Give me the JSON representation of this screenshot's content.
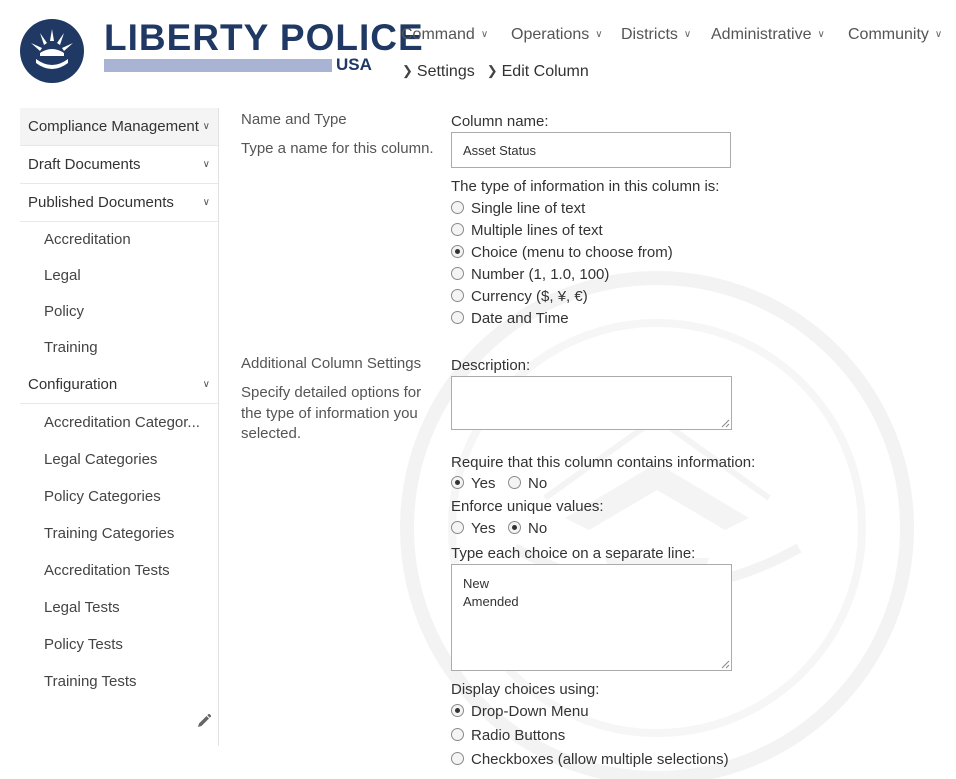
{
  "header": {
    "logo_title": "LIBERTY POLICE",
    "logo_subtitle": "USA",
    "nav": [
      {
        "label": "Command"
      },
      {
        "label": "Operations"
      },
      {
        "label": "Districts"
      },
      {
        "label": "Administrative"
      },
      {
        "label": "Community"
      }
    ],
    "breadcrumb": [
      {
        "label": "Settings"
      },
      {
        "label": "Edit Column"
      }
    ]
  },
  "sidebar": {
    "groups": [
      {
        "label": "Compliance Management",
        "active": true,
        "items": []
      },
      {
        "label": "Draft Documents",
        "items": []
      },
      {
        "label": "Published Documents",
        "items": [
          "Accreditation",
          "Legal",
          "Policy",
          "Training"
        ]
      },
      {
        "label": "Configuration",
        "items": [
          "Accreditation Categor...",
          "Legal Categories",
          "Policy Categories",
          "Training Categories",
          "Accreditation Tests",
          "Legal Tests",
          "Policy Tests",
          "Training Tests"
        ]
      }
    ]
  },
  "form": {
    "name_type": {
      "title": "Name and Type",
      "description": "Type a name for this column.",
      "column_name_label": "Column name:",
      "column_name_value": "Asset Status",
      "type_label": "The type of information in this column is:",
      "types": [
        {
          "label": "Single line of text",
          "selected": false
        },
        {
          "label": "Multiple lines of text",
          "selected": false
        },
        {
          "label": "Choice (menu to choose from)",
          "selected": true
        },
        {
          "label": "Number (1, 1.0, 100)",
          "selected": false
        },
        {
          "label": "Currency ($, ¥, €)",
          "selected": false
        },
        {
          "label": "Date and Time",
          "selected": false
        }
      ]
    },
    "additional": {
      "title": "Additional Column Settings",
      "description": "Specify detailed options for the type of information you selected.",
      "description_label": "Description:",
      "description_value": "",
      "require_label": "Require that this column contains information:",
      "require_options": [
        {
          "label": "Yes",
          "selected": true
        },
        {
          "label": "No",
          "selected": false
        }
      ],
      "unique_label": "Enforce unique values:",
      "unique_options": [
        {
          "label": "Yes",
          "selected": false
        },
        {
          "label": "No",
          "selected": true
        }
      ],
      "choices_label": "Type each choice on a separate line:",
      "choices": [
        "New",
        "Amended"
      ],
      "display_label": "Display choices using:",
      "display_options": [
        {
          "label": "Drop-Down Menu",
          "selected": true
        },
        {
          "label": "Radio Buttons",
          "selected": false
        },
        {
          "label": "Checkboxes (allow multiple selections)",
          "selected": false
        }
      ]
    }
  },
  "colors": {
    "brand": "#1f3864",
    "brand_light": "#a9b3d3",
    "text": "#333333"
  }
}
